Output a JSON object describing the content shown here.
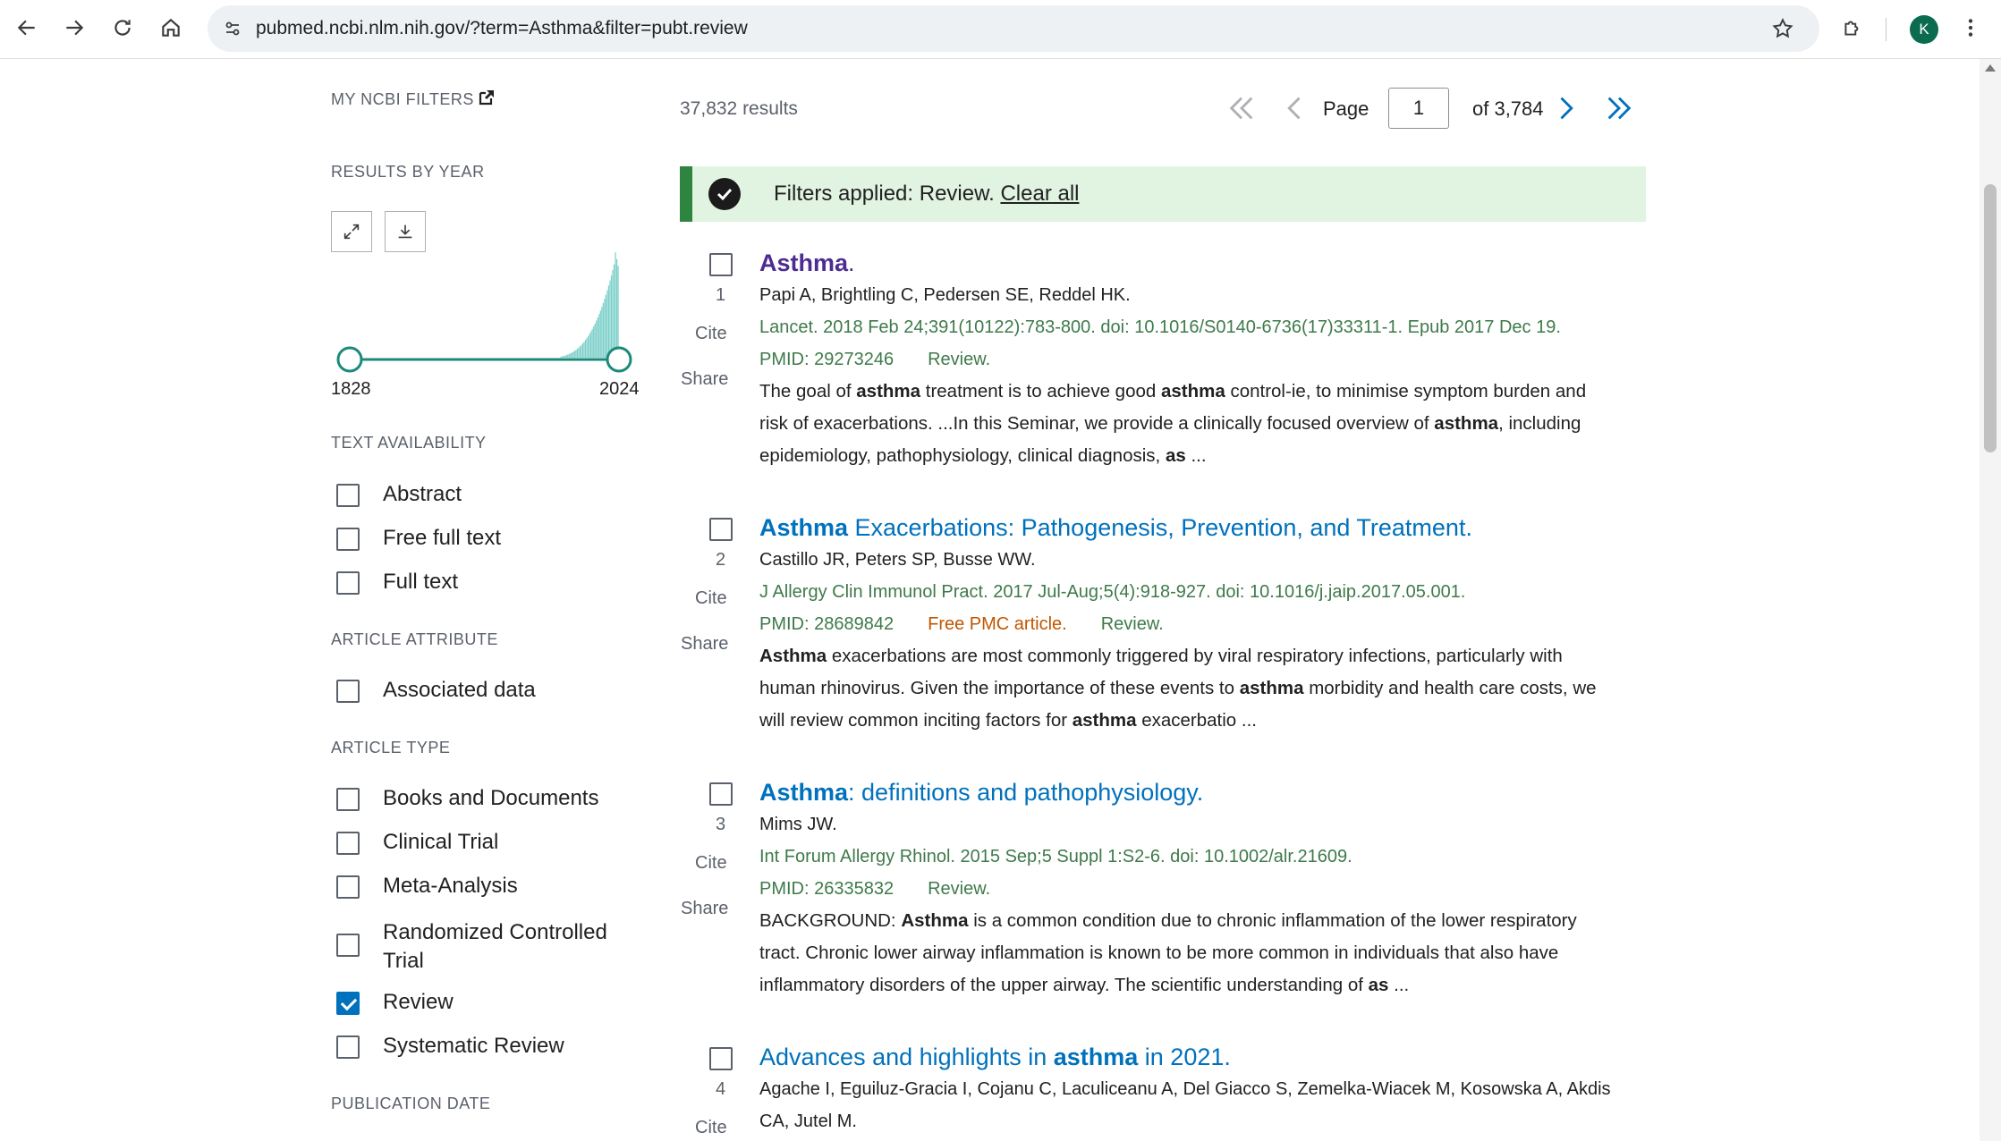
{
  "browser": {
    "url": "pubmed.ncbi.nlm.nih.gov/?term=Asthma&filter=pubt.review",
    "profile_initial": "K"
  },
  "sidebar": {
    "my_ncbi_filters": "MY NCBI FILTERS",
    "results_by_year": "RESULTS BY YEAR",
    "year_start": "1828",
    "year_end": "2024",
    "text_availability": {
      "heading": "TEXT AVAILABILITY",
      "items": [
        {
          "label": "Abstract",
          "checked": false
        },
        {
          "label": "Free full text",
          "checked": false
        },
        {
          "label": "Full text",
          "checked": false
        }
      ]
    },
    "article_attribute": {
      "heading": "ARTICLE ATTRIBUTE",
      "items": [
        {
          "label": "Associated data",
          "checked": false
        }
      ]
    },
    "article_type": {
      "heading": "ARTICLE TYPE",
      "items": [
        {
          "label": "Books and Documents",
          "checked": false
        },
        {
          "label": "Clinical Trial",
          "checked": false
        },
        {
          "label": "Meta-Analysis",
          "checked": false
        },
        {
          "label": "Randomized Controlled Trial",
          "checked": false
        },
        {
          "label": "Review",
          "checked": true
        },
        {
          "label": "Systematic Review",
          "checked": false
        }
      ]
    },
    "publication_date": "PUBLICATION DATE"
  },
  "results": {
    "count": "37,832 results",
    "page_label": "Page",
    "page_value": "1",
    "page_of": "of 3,784",
    "filters_applied": "Filters applied: Review.",
    "clear_all": "Clear all"
  },
  "articles": [
    {
      "num": "1",
      "cite": "Cite",
      "share": "Share",
      "title_bold": "Asthma",
      "title_rest": ".",
      "authors": "Papi A, Brightling C, Pedersen SE, Reddel HK.",
      "journal": "Lancet. 2018 Feb 24;391(10122):783-800. doi: 10.1016/S0140-6736(17)33311-1. Epub 2017 Dec 19.",
      "pmid": "PMID: 29273246",
      "free_pmc": "",
      "review": "Review.",
      "snippet_lines": [
        "The goal of <b>asthma</b> treatment is to achieve good <b>asthma</b> control-ie, to minimise symptom burden and",
        "risk of exacerbations. ...In this Seminar, we provide a clinically focused overview of <b>asthma</b>, including",
        "epidemiology, pathophysiology, clinical diagnosis, <b>as</b> ..."
      ]
    },
    {
      "num": "2",
      "cite": "Cite",
      "share": "Share",
      "title_bold": "Asthma",
      "title_rest": " Exacerbations: Pathogenesis, Prevention, and Treatment.",
      "authors": "Castillo JR, Peters SP, Busse WW.",
      "journal": "J Allergy Clin Immunol Pract. 2017 Jul-Aug;5(4):918-927. doi: 10.1016/j.jaip.2017.05.001.",
      "pmid": "PMID: 28689842",
      "free_pmc": "Free PMC article.",
      "review": "Review.",
      "snippet_lines": [
        "<b>Asthma</b> exacerbations are most commonly triggered by viral respiratory infections, particularly with",
        "human rhinovirus. Given the importance of these events to <b>asthma</b> morbidity and health care costs, we",
        "will review common inciting factors for <b>asthma</b> exacerbatio ..."
      ]
    },
    {
      "num": "3",
      "cite": "Cite",
      "share": "Share",
      "title_bold": "Asthma",
      "title_rest": ": definitions and pathophysiology.",
      "authors": "Mims JW.",
      "journal": "Int Forum Allergy Rhinol. 2015 Sep;5 Suppl 1:S2-6. doi: 10.1002/alr.21609.",
      "pmid": "PMID: 26335832",
      "free_pmc": "",
      "review": "Review.",
      "snippet_lines": [
        "BACKGROUND: <b>Asthma</b> is a common condition due to chronic inflammation of the lower respiratory",
        "tract. Chronic lower airway inflammation is known to be more common in individuals that also have",
        "inflammatory disorders of the upper airway. The scientific understanding of <b>as</b> ..."
      ]
    },
    {
      "num": "4",
      "cite": "Cite",
      "share": "",
      "title_pre": "Advances and highlights in ",
      "title_bold": "asthma",
      "title_rest": " in 2021.",
      "authors_lines": [
        "Agache I, Eguiluz-Gracia I, Cojanu C, Laculiceanu A, Del Giacco S, Zemelka-Wiacek M, Kosowska A, Akdis",
        "CA, Jutel M."
      ]
    }
  ],
  "colors": {
    "link": "#0071bc",
    "visited": "#4c2c92",
    "banner_bg": "#e1f3e1",
    "banner_border": "#2e8540",
    "histogram": "#7ccfc9",
    "slider": "#1b8a7a",
    "free_pmc": "#c05600"
  }
}
